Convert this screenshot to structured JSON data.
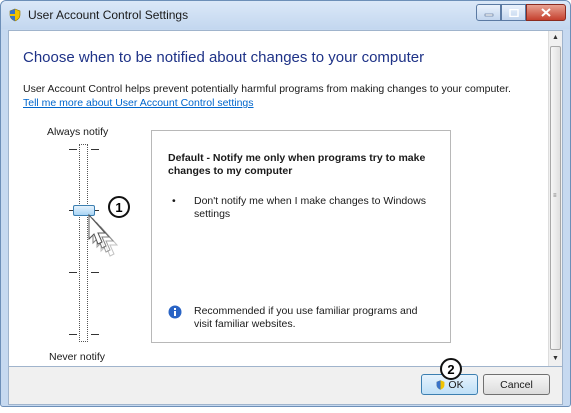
{
  "window": {
    "title": "User Account Control Settings"
  },
  "main": {
    "heading": "Choose when to be notified about changes to your computer",
    "description": "User Account Control helps prevent potentially harmful programs from making changes to your computer.",
    "link": "Tell me more about User Account Control settings"
  },
  "slider": {
    "top_label": "Always notify",
    "bottom_label": "Never notify",
    "level_index": 1,
    "levels": 4
  },
  "info": {
    "title": "Default - Notify me only when programs try to make changes to my computer",
    "bullet": "Don't notify me when I make changes to Windows settings",
    "recommendation": "Recommended if you use familiar programs and visit familiar websites."
  },
  "buttons": {
    "ok": "OK",
    "cancel": "Cancel"
  },
  "callouts": {
    "first": "1",
    "second": "2"
  },
  "colors": {
    "heading": "#1e3287",
    "link": "#0066cc",
    "titlebar": "#c3d7ef"
  }
}
